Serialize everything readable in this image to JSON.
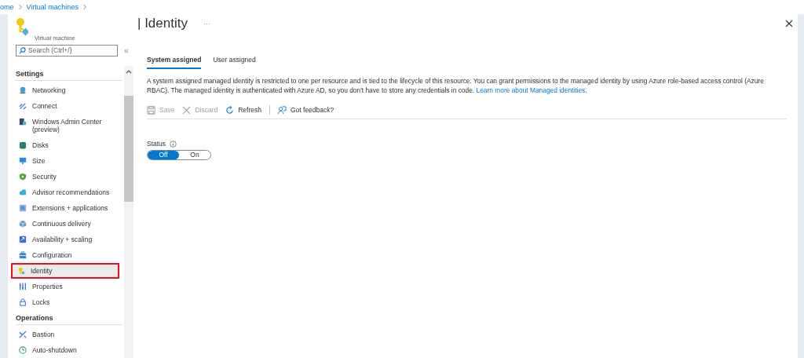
{
  "breadcrumb": [
    {
      "label": "ome"
    },
    {
      "label": "Virtual machines"
    }
  ],
  "resource": {
    "type_label": "Virtual machine",
    "search_placeholder": "Search (Ctrl+/)",
    "collapse": "«"
  },
  "sidebar": {
    "sections": [
      {
        "heading": "Settings",
        "items": [
          {
            "label": "Networking",
            "selected": false
          },
          {
            "label": "Connect",
            "selected": false
          },
          {
            "label": "Windows Admin Center (preview)",
            "selected": false
          },
          {
            "label": "Disks",
            "selected": false
          },
          {
            "label": "Size",
            "selected": false
          },
          {
            "label": "Security",
            "selected": false
          },
          {
            "label": "Advisor recommendations",
            "selected": false
          },
          {
            "label": "Extensions + applications",
            "selected": false
          },
          {
            "label": "Continuous delivery",
            "selected": false
          },
          {
            "label": "Availability + scaling",
            "selected": false
          },
          {
            "label": "Configuration",
            "selected": false
          },
          {
            "label": "Identity",
            "selected": true
          },
          {
            "label": "Properties",
            "selected": false
          },
          {
            "label": "Locks",
            "selected": false
          }
        ]
      },
      {
        "heading": "Operations",
        "items": [
          {
            "label": "Bastion",
            "selected": false
          },
          {
            "label": "Auto-shutdown",
            "selected": false
          }
        ]
      }
    ]
  },
  "page": {
    "title": "| Identity",
    "more": "···"
  },
  "tabs": [
    {
      "label": "System assigned",
      "selected": true
    },
    {
      "label": "User assigned",
      "selected": false
    }
  ],
  "description": "A system assigned managed identity is restricted to one per resource and is tied to the lifecycle of this resource. You can grant permissions to the managed identity by using Azure role-based access control (Azure RBAC). The managed identity is authenticated with Azure AD, so you don't have to store any credentials in code.",
  "description_link": "Learn more about Managed identities",
  "description_end": ".",
  "toolbar": [
    {
      "label": "Save",
      "kind": "save",
      "disabled": true
    },
    {
      "label": "Discard",
      "kind": "discard",
      "disabled": true
    },
    {
      "label": "Refresh",
      "kind": "refresh",
      "disabled": false
    },
    {
      "label": "Got feedback?",
      "kind": "feedback",
      "disabled": false
    }
  ],
  "status": {
    "label": "Status",
    "options": [
      {
        "label": "Off",
        "selected": true
      },
      {
        "label": "On",
        "selected": false
      }
    ]
  }
}
